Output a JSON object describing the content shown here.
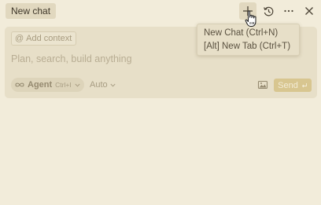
{
  "header": {
    "tab_label": "New chat",
    "icons": [
      "plus-icon",
      "history-icon",
      "more-icon",
      "close-icon"
    ]
  },
  "composer": {
    "context_label": "Add context",
    "context_symbol": "@",
    "placeholder": "Plan, search, build anything",
    "agent": {
      "label": "Agent",
      "shortcut": "Ctrl+I"
    },
    "model": "Auto",
    "send_label": "Send"
  },
  "tooltip": {
    "line1": "New Chat (Ctrl+N)",
    "line2": "[Alt] New Tab (Ctrl+T)"
  },
  "colors": {
    "background": "#f2ecda",
    "composer": "#e7dfc8",
    "send_button": "#d8c690",
    "text": "#5a5140"
  }
}
